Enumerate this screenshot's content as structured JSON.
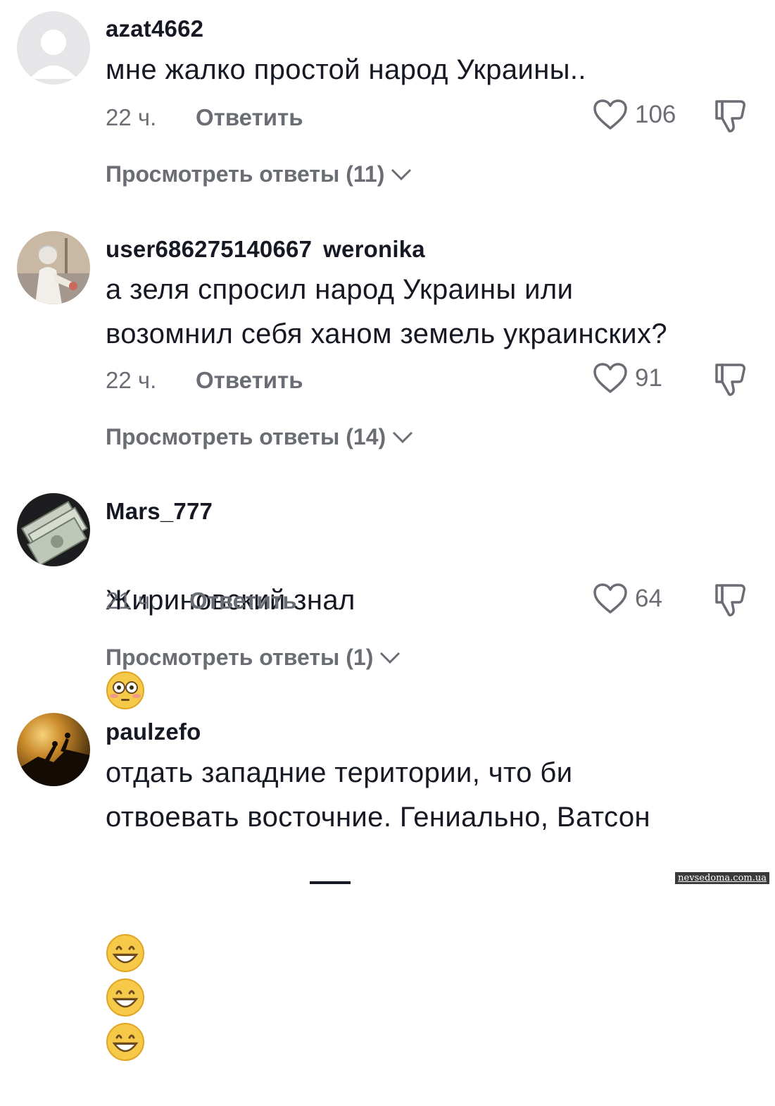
{
  "comments": [
    {
      "username": "azat4662",
      "username_secondary": "",
      "text": "мне жалко простой народ Украины..",
      "time": "22 ч.",
      "reply_label": "Ответить",
      "likes": "106",
      "view_replies": "Просмотреть ответы (11)"
    },
    {
      "username": "user686275140667",
      "username_secondary": "weronika",
      "text": "а зеля спросил народ Украины или\nвозомнил себя ханом земель украинских?",
      "time": "22 ч.",
      "reply_label": "Ответить",
      "likes": "91",
      "view_replies": "Просмотреть ответы (14)"
    },
    {
      "username": "Mars_777",
      "username_secondary": "",
      "text": "Жириновский знал",
      "time": "21 ч.",
      "reply_label": "Ответить",
      "likes": "64",
      "view_replies": "Просмотреть ответы (1)"
    },
    {
      "username": "paulzefo",
      "username_secondary": "",
      "text": "отдать западние територии, что би\nотвоевать восточние. Гениально, Ватсон"
    }
  ],
  "watermark": "nevsedoma.com.ua",
  "colors": {
    "text": "#161823",
    "muted": "#6b6d74",
    "background": "#ffffff"
  },
  "icons": [
    "default-avatar-icon",
    "heart-icon",
    "dislike-icon",
    "chevron-down-icon",
    "flushed-face-emoji",
    "grinning-face-emoji"
  ]
}
